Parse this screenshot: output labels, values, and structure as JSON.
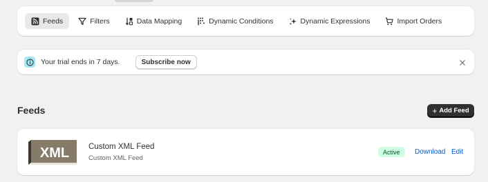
{
  "nav": {
    "tabs": [
      {
        "label": "Feeds",
        "icon": "rss-icon",
        "active": true
      },
      {
        "label": "Filters",
        "icon": "filter-icon",
        "active": false
      },
      {
        "label": "Data Mapping",
        "icon": "sort-icon",
        "active": false
      },
      {
        "label": "Dynamic Conditions",
        "icon": "conditions-icon",
        "active": false
      },
      {
        "label": "Dynamic Expressions",
        "icon": "sparkle-icon",
        "active": false
      },
      {
        "label": "Import Orders",
        "icon": "cart-icon",
        "active": false
      }
    ]
  },
  "banner": {
    "text": "Your trial ends in 7 days.",
    "button_label": "Subscribe now",
    "icon": "info-icon",
    "close_icon": "close-icon"
  },
  "header": {
    "title": "Feeds",
    "add_button_label": "Add Feed"
  },
  "feeds": [
    {
      "thumb_text": "XML",
      "name": "Custom XML Feed",
      "subtitle": "Custom XML Feed",
      "status": "Active",
      "download_label": "Download",
      "edit_label": "Edit"
    }
  ],
  "colors": {
    "accent": "#005bd3",
    "badge_bg": "#cdfee1",
    "badge_text": "#0c5132",
    "info_bg": "#a4e8f2",
    "thumb_bg": "#857b68",
    "primary_button": "#303030"
  }
}
